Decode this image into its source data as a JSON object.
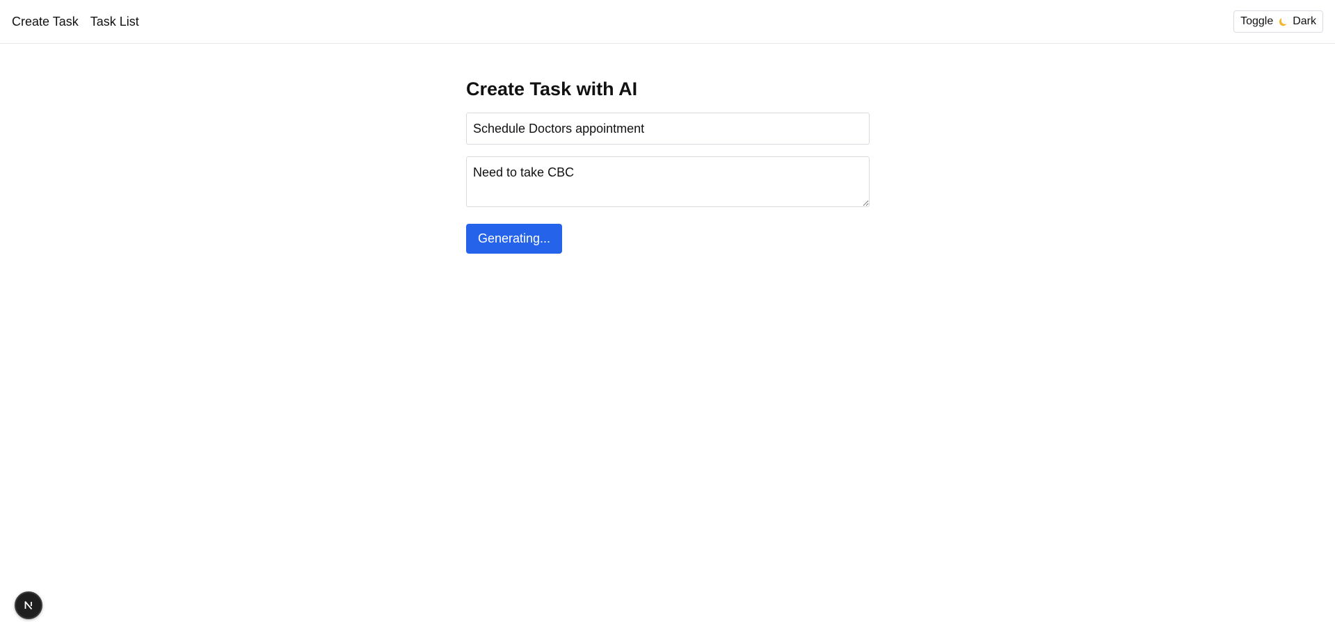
{
  "nav": {
    "items": [
      {
        "label": "Create Task"
      },
      {
        "label": "Task List"
      }
    ]
  },
  "theme_toggle": {
    "label_before": "Toggle",
    "icon": "moon-icon",
    "label_after": "Dark"
  },
  "main": {
    "heading": "Create Task with AI",
    "title_input": {
      "value": "Schedule Doctors appointment"
    },
    "description_input": {
      "value": "Need to take CBC"
    },
    "generate_button": {
      "label": "Generating..."
    }
  },
  "dev_badge": {
    "letter": "N",
    "icon": "nextjs-logo-icon"
  },
  "colors": {
    "accent": "#2563eb",
    "border": "#d7dbe0",
    "divider": "#e5e7eb",
    "moon": "#f4b731",
    "badge_bg": "#1f1f1f"
  }
}
